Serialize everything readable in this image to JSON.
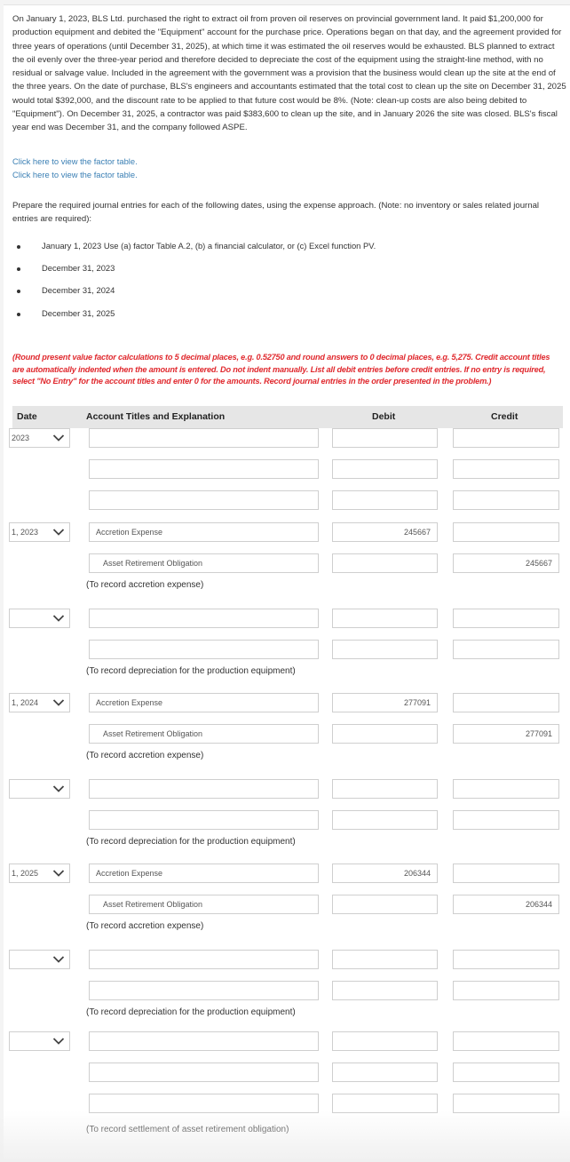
{
  "problem_text": "On January 1, 2023, BLS Ltd. purchased the right to extract oil from proven oil reserves on provincial government land. It paid $1,200,000 for production equipment and debited the \"Equipment\" account for the purchase price. Operations began on that day, and the agreement provided for three years of operations (until December 31, 2025), at which time it was estimated the oil reserves would be exhausted. BLS planned to extract the oil evenly over the three-year period and therefore decided to depreciate the cost of the equipment using the straight-line method, with no residual or salvage value. Included in the agreement with the government was a provision that the business would clean up the site at the end of the three years. On the date of purchase, BLS's engineers and accountants estimated that the total cost to clean up the site on December 31, 2025 would total $392,000, and the discount rate to be applied to that future cost would be 8%. (Note: clean-up costs are also being debited to \"Equipment\"). On December 31, 2025, a contractor was paid $383,600 to clean up the site, and in January 2026 the site was closed. BLS's fiscal year end was December 31, and the company followed ASPE.",
  "links": [
    "Click here to view the factor table.",
    "Click here to view the factor table."
  ],
  "prepare_text": "Prepare the required journal entries for each of the following dates, using the expense approach. (Note: no inventory or sales related journal entries are required):",
  "bullets": [
    "January 1, 2023 Use (a) factor Table A.2, (b) a financial calculator, or (c) Excel function PV.",
    "December 31, 2023",
    "December 31, 2024",
    "December 31, 2025"
  ],
  "instructions": "(Round present value factor calculations to 5 decimal places, e.g. 0.52750 and round answers to 0 decimal places, e.g. 5,275. Credit account titles are automatically indented when the amount is entered. Do not indent manually. List all debit entries before credit entries. If no entry is required, select \"No Entry\" for the account titles and enter 0 for the amounts. Record journal entries in the order presented in the problem.)",
  "table": {
    "headers": {
      "date": "Date",
      "account": "Account Titles and Explanation",
      "debit": "Debit",
      "credit": "Credit"
    },
    "rows": [
      {
        "date": "2023",
        "account": "",
        "debit": "",
        "credit": ""
      },
      {
        "date": "",
        "account": "",
        "debit": "",
        "credit": ""
      },
      {
        "date": "",
        "account": "",
        "debit": "",
        "credit": ""
      },
      {
        "date": "1, 2023",
        "account": "Accretion Expense",
        "debit": "245667",
        "credit": ""
      },
      {
        "date": "",
        "account": "Asset Retirement Obligation",
        "debit": "",
        "credit": "245667"
      },
      {
        "date": "",
        "account": "",
        "debit": "",
        "credit": ""
      },
      {
        "date": "",
        "account": "",
        "debit": "",
        "credit": ""
      },
      {
        "date": "1, 2024",
        "account": "Accretion Expense",
        "debit": "277091",
        "credit": ""
      },
      {
        "date": "",
        "account": "Asset Retirement Obligation",
        "debit": "",
        "credit": "277091"
      },
      {
        "date": "",
        "account": "",
        "debit": "",
        "credit": ""
      },
      {
        "date": "",
        "account": "",
        "debit": "",
        "credit": ""
      },
      {
        "date": "1, 2025",
        "account": "Accretion Expense",
        "debit": "206344",
        "credit": ""
      },
      {
        "date": "",
        "account": "Asset Retirement Obligation",
        "debit": "",
        "credit": "206344"
      },
      {
        "date": "",
        "account": "",
        "debit": "",
        "credit": ""
      },
      {
        "date": "",
        "account": "",
        "debit": "",
        "credit": ""
      },
      {
        "date": "",
        "account": "",
        "debit": "",
        "credit": ""
      },
      {
        "date": "",
        "account": "",
        "debit": "",
        "credit": ""
      },
      {
        "date": "",
        "account": "",
        "debit": "",
        "credit": ""
      }
    ],
    "memos": [
      "(To record accretion expense)",
      "(To record depreciation for the production equipment)",
      "(To record accretion expense)",
      "(To record depreciation for the production equipment)",
      "(To record accretion expense)",
      "(To record depreciation for the production equipment)",
      "(To record settlement of asset retirement obligation)"
    ]
  }
}
